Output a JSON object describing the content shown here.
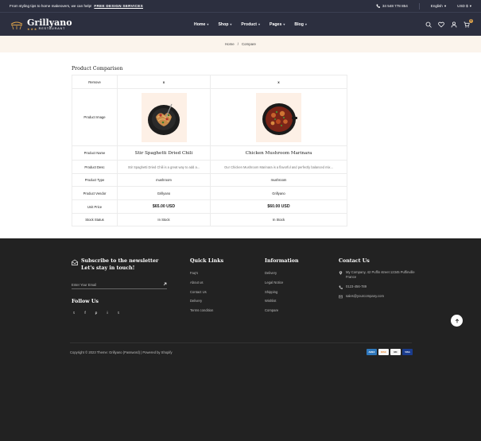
{
  "topbar": {
    "promo_text": "From styling tips to home makeovers, we can help!",
    "promo_link": "FREE DESIGN SERVICES",
    "phone": "34 548 778 854",
    "language": "English",
    "currency": "USD $"
  },
  "header": {
    "brand": "Grillyano",
    "tagline": "RESTAURANT",
    "nav": [
      {
        "label": "Home"
      },
      {
        "label": "Shop"
      },
      {
        "label": "Product"
      },
      {
        "label": "Pages"
      },
      {
        "label": "Blog"
      }
    ],
    "cart_count": "0"
  },
  "breadcrumb": {
    "home": "Home",
    "sep": "/",
    "current": "Compare"
  },
  "compare": {
    "title": "Product Comparison",
    "labels": {
      "remove": "Remove",
      "image": "Product Image",
      "name": "Product Name",
      "desc": "Product Desc",
      "type": "Product Type",
      "vendor": "Product Vendor",
      "price": "Unit Price",
      "stock": "Stock Status"
    },
    "products": [
      {
        "remove": "x",
        "name": "Stir Spaghetti Dried Chili",
        "desc": "Stir Spaghetti Dried Chili is a great way to add a...",
        "type": "mushroom",
        "vendor": "Grillyano",
        "price": "$65.00 USD",
        "stock": "In Stock"
      },
      {
        "remove": "x",
        "name": "Chicken Mushroom Marinara",
        "desc": "Our Chicken Mushroom Marinara is a flavorful and perfectly balanced mix...",
        "type": "mushroom",
        "vendor": "Grillyano",
        "price": "$60.00 USD",
        "stock": "In Stock"
      }
    ]
  },
  "footer": {
    "newsletter_title": "Subscribe to the newsletter Let's stay in touch!",
    "email_placeholder": "Enter Your Email",
    "follow_title": "Follow Us",
    "social": [
      "t",
      "f",
      "p",
      "i",
      "t"
    ],
    "quick_links": {
      "title": "Quick Links",
      "items": [
        "Faq's",
        "About us",
        "Contact Us",
        "Delivery",
        "Terms condition"
      ]
    },
    "information": {
      "title": "Information",
      "items": [
        "Delivery",
        "Legal Notice",
        "Shipping",
        "Wishlist",
        "Compare"
      ]
    },
    "contact": {
      "title": "Contact Us",
      "address": "My Company, 42 Puffin street 12345 Puffinville France",
      "phone": "0123-456-789",
      "email": "sales@yourcompany.com"
    },
    "copyright": "Copyright © 2023 Theme: Grillyano (Password) | Powered by Shopify",
    "payments": [
      "AMEX",
      "DISC",
      "MC",
      "VISA"
    ]
  },
  "colors": {
    "header_bg": "#2c2f3f",
    "accent": "#e0a44a",
    "footer_bg": "#222222",
    "crumb_bg": "#fbf4ec",
    "in_stock": "#4caf50"
  }
}
